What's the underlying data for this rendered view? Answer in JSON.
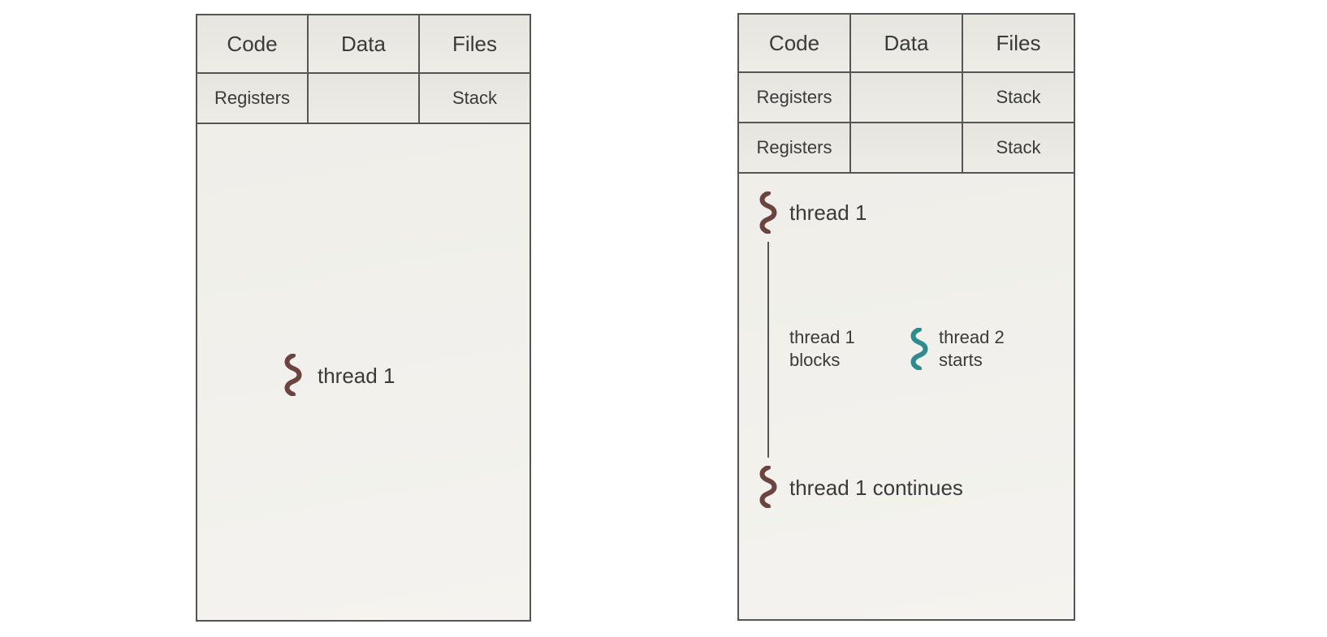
{
  "left": {
    "row1": {
      "c1": "Code",
      "c2": "Data",
      "c3": "Files"
    },
    "row2": {
      "c1": "Registers",
      "c2": "",
      "c3": "Stack"
    },
    "thread1_label": "thread 1"
  },
  "right": {
    "row1": {
      "c1": "Code",
      "c2": "Data",
      "c3": "Files"
    },
    "row2": {
      "c1": "Registers",
      "c2": "",
      "c3": "Stack"
    },
    "row3": {
      "c1": "Registers",
      "c2": "",
      "c3": "Stack"
    },
    "thread1_label": "thread 1",
    "thread1_blocks": "thread 1\nblocks",
    "thread2_starts": "thread 2\nstarts",
    "thread1_continues": "thread 1 continues"
  },
  "colors": {
    "brown": "#6b443f",
    "teal": "#2f8c8e"
  }
}
